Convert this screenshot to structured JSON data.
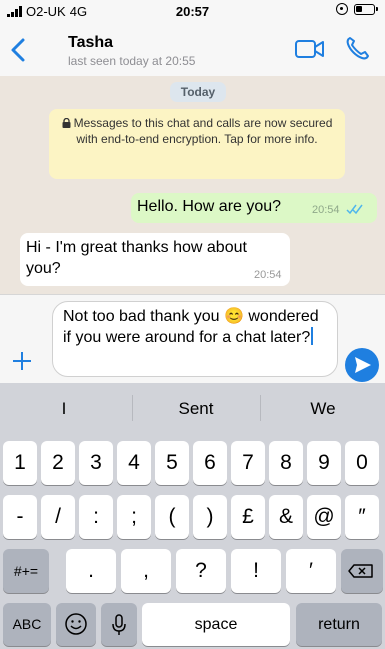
{
  "status_bar": {
    "carrier": "O2-UK",
    "network": "4G",
    "time": "20:57",
    "icons": [
      "signal-icon",
      "orientation-lock-icon",
      "battery-icon"
    ]
  },
  "header": {
    "back_icon": "chevron-left-icon",
    "contact_name": "Tasha",
    "last_seen": "last seen today at 20:55",
    "video_icon": "video-camera-icon",
    "call_icon": "phone-icon",
    "accent": "#1f7fe0"
  },
  "chat": {
    "date_label": "Today",
    "encryption_notice": "Messages to this chat and calls are now secured with end-to-end encryption. Tap for more info.",
    "messages": [
      {
        "direction": "outgoing",
        "text": "Hello. How are you?",
        "time": "20:54",
        "status_icon": "double-check-icon"
      },
      {
        "direction": "incoming",
        "text": "Hi - I'm great thanks how about you?",
        "time": "20:54"
      }
    ]
  },
  "composer": {
    "add_icon": "plus-icon",
    "draft_text": "Not too bad thank you 😊 wondered if you were around for a chat later?",
    "send_icon": "send-arrow-icon"
  },
  "keyboard": {
    "suggestions": [
      "I",
      "Sent",
      "We"
    ],
    "row1": [
      "1",
      "2",
      "3",
      "4",
      "5",
      "6",
      "7",
      "8",
      "9",
      "0"
    ],
    "row2": [
      "-",
      "/",
      ":",
      ";",
      "(",
      ")",
      "£",
      "&",
      "@",
      "″"
    ],
    "row3_left": "#+=",
    "row3": [
      ".",
      ",",
      "?",
      "!",
      "′"
    ],
    "backspace_icon": "backspace-icon",
    "abc_label": "ABC",
    "emoji_icon": "emoji-icon",
    "mic_icon": "microphone-icon",
    "space_label": "space",
    "return_label": "return"
  }
}
